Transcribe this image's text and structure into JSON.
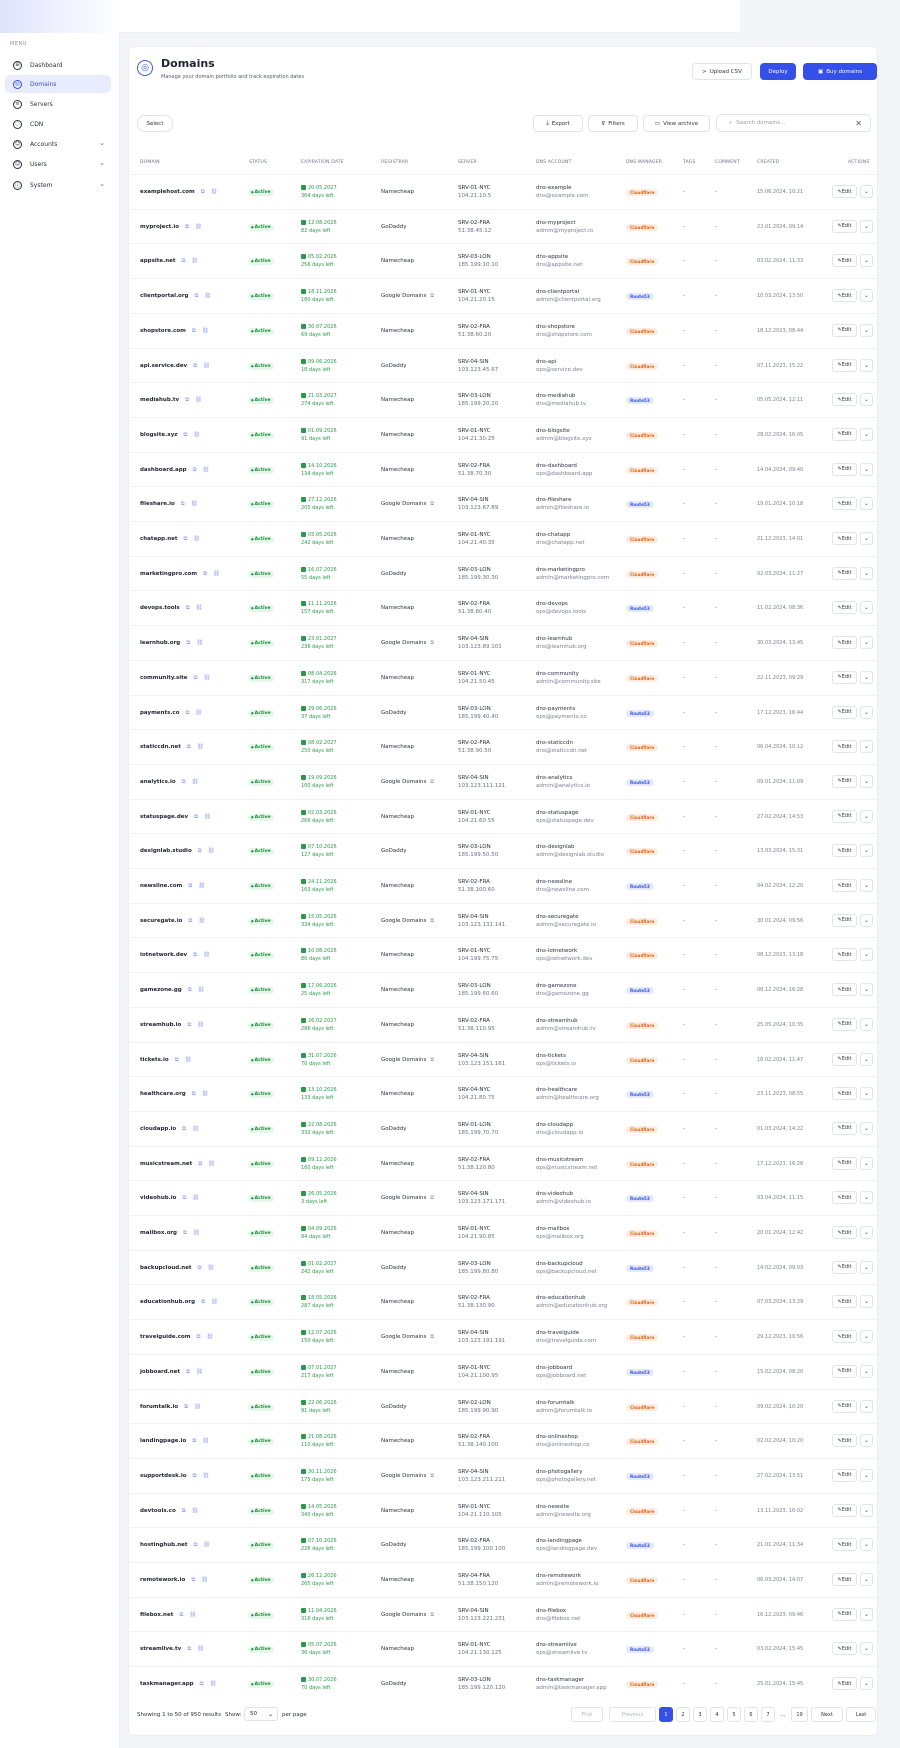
{
  "sidebar": {
    "menu_label": "MENU",
    "items": [
      {
        "label": "Dashboard",
        "icon": "dashboard-icon",
        "glyph": "⊞",
        "active": false,
        "chevron": false
      },
      {
        "label": "Domains",
        "icon": "globe-icon",
        "glyph": "◎",
        "active": true,
        "chevron": false
      },
      {
        "label": "Servers",
        "icon": "server-icon",
        "glyph": "≡",
        "active": false,
        "chevron": false
      },
      {
        "label": "CDN",
        "icon": "cdn-icon",
        "glyph": "◌",
        "active": false,
        "chevron": false
      },
      {
        "label": "Accounts",
        "icon": "accounts-icon",
        "glyph": "☺",
        "active": false,
        "chevron": true
      },
      {
        "label": "Users",
        "icon": "users-icon",
        "glyph": "☺",
        "active": false,
        "chevron": true
      },
      {
        "label": "System",
        "icon": "system-icon",
        "glyph": "ⓘ",
        "active": false,
        "chevron": true
      }
    ]
  },
  "header": {
    "title": "Domains",
    "subtitle": "Manage your domain portfolio and track expiration dates",
    "upload_label": "Upload CSV",
    "deploy_label": "Deploy",
    "buy_label": "Buy domains"
  },
  "toolbar": {
    "select_label": "Select",
    "export_label": "Export",
    "filters_label": "Filters",
    "archive_label": "View archive",
    "search_placeholder": "Search domains..."
  },
  "table": {
    "columns": [
      "DOMAIN",
      "STATUS",
      "EXPIRATION DATE",
      "REGISTRAR",
      "SERVER",
      "DNS ACCOUNT",
      "DNS MANAGER",
      "TAGS",
      "COMMENT",
      "CREATED",
      "ACTIONS"
    ],
    "status_label": "Active",
    "edit_label": "Edit",
    "rows": [
      [
        "examplehost.com",
        "20.05.2027",
        "364 days left",
        "Namecheap",
        "SRV-01-NYC",
        "104.21.10.5",
        "dns-example",
        "dns@example.com",
        "Cloudflare",
        "15.06.2024, 10:21"
      ],
      [
        "myproject.io",
        "12.08.2026",
        "82 days left",
        "GoDaddy",
        "SRV-02-FRA",
        "51.38.45.12",
        "dns-myproject",
        "admin@myproject.io",
        "Cloudflare",
        "22.01.2024, 09:14"
      ],
      [
        "appsite.net",
        "05.02.2026",
        "256 days left",
        "Namecheap",
        "SRV-03-LON",
        "185.199.10.10",
        "dns-appsite",
        "dns@appsite.net",
        "Cloudflare",
        "03.02.2024, 11:33"
      ],
      [
        "clientportal.org",
        "18.11.2026",
        "180 days left",
        "Google Domains",
        "SRV-01-NYC",
        "104.21.20.15",
        "dns-clientportal",
        "admin@clientportal.org",
        "Route53",
        "10.03.2024, 13:50"
      ],
      [
        "shopstore.com",
        "30.07.2026",
        "69 days left",
        "Namecheap",
        "SRV-02-FRA",
        "51.38.60.20",
        "dns-shopstore",
        "dns@shopstore.com",
        "Cloudflare",
        "18.12.2023, 08:44"
      ],
      [
        "api.service.dev",
        "09.06.2026",
        "18 days left",
        "GoDaddy",
        "SRV-04-SIN",
        "103.123.45.67",
        "dns-api",
        "ops@service.dev",
        "Cloudflare",
        "07.11.2023, 15:22"
      ],
      [
        "mediahub.tv",
        "21.03.2027",
        "274 days left",
        "Namecheap",
        "SRV-03-LON",
        "185.199.20.20",
        "dns-mediahub",
        "dns@mediahub.tv",
        "Route53",
        "05.05.2024, 12:11"
      ],
      [
        "blogsite.xyz",
        "01.09.2026",
        "91 days left",
        "Namecheap",
        "SRV-01-NYC",
        "104.21.30.25",
        "dns-blogsite",
        "admin@blogsite.xyz",
        "Cloudflare",
        "28.02.2024, 16:05"
      ],
      [
        "dashboard.app",
        "14.10.2026",
        "134 days left",
        "Namecheap",
        "SRV-02-FRA",
        "51.38.70.30",
        "dns-dashboard",
        "ops@dashboard.app",
        "Cloudflare",
        "14.04.2024, 09:40"
      ],
      [
        "fileshare.io",
        "27.12.2026",
        "205 days left",
        "Google Domains",
        "SRV-04-SIN",
        "103.123.67.89",
        "dns-fileshare",
        "admin@fileshare.io",
        "Route53",
        "19.01.2024, 10:18"
      ],
      [
        "chatapp.net",
        "03.05.2026",
        "242 days left",
        "Namecheap",
        "SRV-01-NYC",
        "104.21.40.35",
        "dns-chatapp",
        "dns@chatapp.net",
        "Cloudflare",
        "21.12.2023, 14:01"
      ],
      [
        "marketingpro.com",
        "16.07.2026",
        "55 days left",
        "GoDaddy",
        "SRV-03-LON",
        "185.199.30.30",
        "dns-marketingpro",
        "admin@marketingpro.com",
        "Cloudflare",
        "02.03.2024, 11:27"
      ],
      [
        "devops.tools",
        "11.11.2026",
        "157 days left",
        "Namecheap",
        "SRV-02-FRA",
        "51.38.80.40",
        "dns-devops",
        "ops@devops.tools",
        "Route53",
        "11.02.2024, 08:36"
      ],
      [
        "learnhub.org",
        "23.01.2027",
        "236 days left",
        "Google Domains",
        "SRV-04-SIN",
        "103.123.89.101",
        "dns-learnhub",
        "dns@learnhub.org",
        "Cloudflare",
        "30.03.2024, 13:45"
      ],
      [
        "community.site",
        "08.04.2026",
        "317 days left",
        "Namecheap",
        "SRV-01-NYC",
        "104.21.50.45",
        "dns-community",
        "admin@community.site",
        "Cloudflare",
        "22.11.2023, 09:29"
      ],
      [
        "payments.co",
        "29.06.2026",
        "37 days left",
        "GoDaddy",
        "SRV-03-LON",
        "185.199.40.40",
        "dns-payments",
        "ops@payments.co",
        "Route53",
        "17.12.2023, 16:44"
      ],
      [
        "staticcdn.net",
        "08.02.2027",
        "250 days left",
        "Namecheap",
        "SRV-02-FRA",
        "51.38.90.50",
        "dns-staticcdn",
        "dns@staticcdn.net",
        "Cloudflare",
        "06.04.2024, 10:12"
      ],
      [
        "analytics.io",
        "19.09.2026",
        "100 days left",
        "Google Domains",
        "SRV-04-SIN",
        "103.123.111.121",
        "dns-analytics",
        "admin@analytics.io",
        "Route53",
        "09.01.2024, 11:09"
      ],
      [
        "statuspage.dev",
        "02.03.2026",
        "266 days left",
        "Namecheap",
        "SRV-01-NYC",
        "104.21.60.55",
        "dns-statuspage",
        "ops@statuspage.dev",
        "Cloudflare",
        "27.02.2024, 14:53"
      ],
      [
        "designlab.studio",
        "07.10.2026",
        "127 days left",
        "GoDaddy",
        "SRV-03-LON",
        "185.199.50.50",
        "dns-designlab",
        "admin@designlab.studio",
        "Cloudflare",
        "13.03.2024, 15:31"
      ],
      [
        "newsline.com",
        "24.11.2026",
        "163 days left",
        "Namecheap",
        "SRV-02-FRA",
        "51.38.100.60",
        "dns-newsline",
        "dns@newsline.com",
        "Route53",
        "04.02.2024, 12:20"
      ],
      [
        "securegate.io",
        "15.05.2026",
        "334 days left",
        "Google Domains",
        "SRV-04-SIN",
        "103.123.131.141",
        "dns-securegate",
        "admin@securegate.io",
        "Cloudflare",
        "30.01.2024, 09:56"
      ],
      [
        "iotnetwork.dev",
        "10.08.2026",
        "80 days left",
        "Namecheap",
        "SRV-01-NYC",
        "104.199.75.75",
        "dns-iotnetwork",
        "ops@iotnetwork.dev",
        "Cloudflare",
        "08.12.2023, 13:18"
      ],
      [
        "gamezone.gg",
        "17.06.2026",
        "25 days left",
        "Namecheap",
        "SRV-03-LON",
        "185.199.60.60",
        "dns-gamezone",
        "dns@gamezone.gg",
        "Route53",
        "08.12.2024, 16:28"
      ],
      [
        "streamhub.io",
        "26.02.2027",
        "286 days left",
        "Namecheap",
        "SRV-02-FRA",
        "51.38.110.95",
        "dns-streamhub",
        "admin@streamhub.tv",
        "Cloudflare",
        "25.05.2024, 10:35"
      ],
      [
        "tickets.io",
        "31.07.2026",
        "70 days left",
        "Google Domains",
        "SRV-04-SIN",
        "103.123.151.161",
        "dns-tickets",
        "ops@tickets.io",
        "Cloudflare",
        "18.02.2024, 11:47"
      ],
      [
        "healthcare.org",
        "13.10.2026",
        "133 days left",
        "Namecheap",
        "SRV-04-NYC",
        "104.21.80.75",
        "dns-healthcare",
        "admin@healthcare.org",
        "Route53",
        "23.11.2023, 08:55"
      ],
      [
        "cloudapp.io",
        "22.08.2026",
        "332 days left",
        "GoDaddy",
        "SRV-01-LON",
        "185.199.70.70",
        "dns-cloudapp",
        "dns@cloudapp.io",
        "Cloudflare",
        "01.03.2024, 14:22"
      ],
      [
        "musicstream.net",
        "09.12.2026",
        "160 days left",
        "Namecheap",
        "SRV-02-FRA",
        "51.38.120.80",
        "dns-musicstream",
        "ops@musicstream.net",
        "Cloudflare",
        "17.12.2023, 16:28"
      ],
      [
        "videohub.io",
        "26.05.2026",
        "3 days left",
        "Google Domains",
        "SRV-04-SIN",
        "103.123.171.171",
        "dns-videohub",
        "admin@videohub.io",
        "Route53",
        "03.04.2024, 11:15"
      ],
      [
        "mailbox.org",
        "04.09.2026",
        "94 days left",
        "Namecheap",
        "SRV-01-NYC",
        "104.21.90.85",
        "dns-mailbox",
        "ops@mailbox.org",
        "Cloudflare",
        "20.01.2024, 12:42"
      ],
      [
        "backupcloud.net",
        "01.02.2027",
        "242 days left",
        "GoDaddy",
        "SRV-03-LON",
        "185.199.80.80",
        "dns-backupcloud",
        "ops@backupcloud.net",
        "Route53",
        "14.02.2024, 09:03"
      ],
      [
        "educationhub.org",
        "18.05.2026",
        "287 days left",
        "Namecheap",
        "SRV-02-FRA",
        "51.38.130.90",
        "dns-educationhub",
        "admin@educationhub.org",
        "Cloudflare",
        "07.03.2024, 13:29"
      ],
      [
        "travelguide.com",
        "12.07.2026",
        "150 days left",
        "Google Domains",
        "SRV-04-SIN",
        "103.123.191.191",
        "dns-travelguide",
        "dns@travelguide.com",
        "Cloudflare",
        "29.12.2023, 10:56"
      ],
      [
        "jobboard.net",
        "07.01.2027",
        "217 days left",
        "Namecheap",
        "SRV-01-NYC",
        "104.21.100.95",
        "dns-jobboard",
        "ops@jobboard.net",
        "Route53",
        "15.02.2024, 08:20"
      ],
      [
        "forumtalk.io",
        "22.06.2026",
        "91 days left",
        "GoDaddy",
        "SRV-02-LON",
        "185.199.90.90",
        "dns-forumtalk",
        "admin@forumtalk.io",
        "Cloudflare",
        "09.02.2024, 10:20"
      ],
      [
        "landingpage.io",
        "21.08.2026",
        "110 days left",
        "Namecheap",
        "SRV-02-FRA",
        "51.38.140.100",
        "dns-onlineshop",
        "dns@onlineshop.co",
        "Cloudflare",
        "02.02.2024, 10:20"
      ],
      [
        "supportdesk.io",
        "30.11.2026",
        "175 days left",
        "Google Domains",
        "SRV-04-SIN",
        "103.123.211.211",
        "dns-photogallery",
        "ops@photogallery.net",
        "Route53",
        "27.02.2024, 13:51"
      ],
      [
        "devtools.co",
        "14.05.2026",
        "340 days left",
        "Namecheap",
        "SRV-01-NYC",
        "104.21.110.105",
        "dns-newsite",
        "admin@newsite.org",
        "Cloudflare",
        "13.11.2023, 16:02"
      ],
      [
        "hostinghub.net",
        "07.10.2026",
        "226 days left",
        "GoDaddy",
        "SRV-02-FRA",
        "185.199.100.100",
        "dns-landingpage",
        "ops@landingpage.dev",
        "Route53",
        "21.01.2024, 11:34"
      ],
      [
        "remotework.io",
        "26.12.2026",
        "265 days left",
        "Namecheap",
        "SRV-04-FRA",
        "51.38.150.120",
        "dns-remotework",
        "admin@remotework.io",
        "Cloudflare",
        "06.03.2024, 14:07"
      ],
      [
        "filebox.net",
        "11.04.2026",
        "316 days left",
        "Google Domains",
        "SRV-04-SIN",
        "103.123.221.231",
        "dns-filebox",
        "dns@filebox.net",
        "Cloudflare",
        "16.12.2023, 09:46"
      ],
      [
        "streamlive.tv",
        "05.07.2026",
        "36 days left",
        "Namecheap",
        "SRV-01-NYC",
        "104.21.130.125",
        "dns-streamlive",
        "ops@streamlive.tv",
        "Route53",
        "03.02.2024, 15:45"
      ],
      [
        "taskmanager.app",
        "30.07.2026",
        "70 days left",
        "GoDaddy",
        "SRV-03-LON",
        "185.199.120.120",
        "dns-taskmanager",
        "admin@taskmanager.app",
        "Cloudflare",
        "25.01.2024, 15:45"
      ]
    ]
  },
  "footer": {
    "results_text": "Showing 1 to 50 of 950 results",
    "show_label": "Show:",
    "per_page_value": "50",
    "per_page_label": "per page",
    "first_label": "First",
    "previous_label": "Previous",
    "pages": [
      "1",
      "2",
      "3",
      "4",
      "5",
      "6",
      "7"
    ],
    "ellipsis": "...",
    "last_page": "19",
    "next_label": "Next",
    "last_label": "Last"
  }
}
